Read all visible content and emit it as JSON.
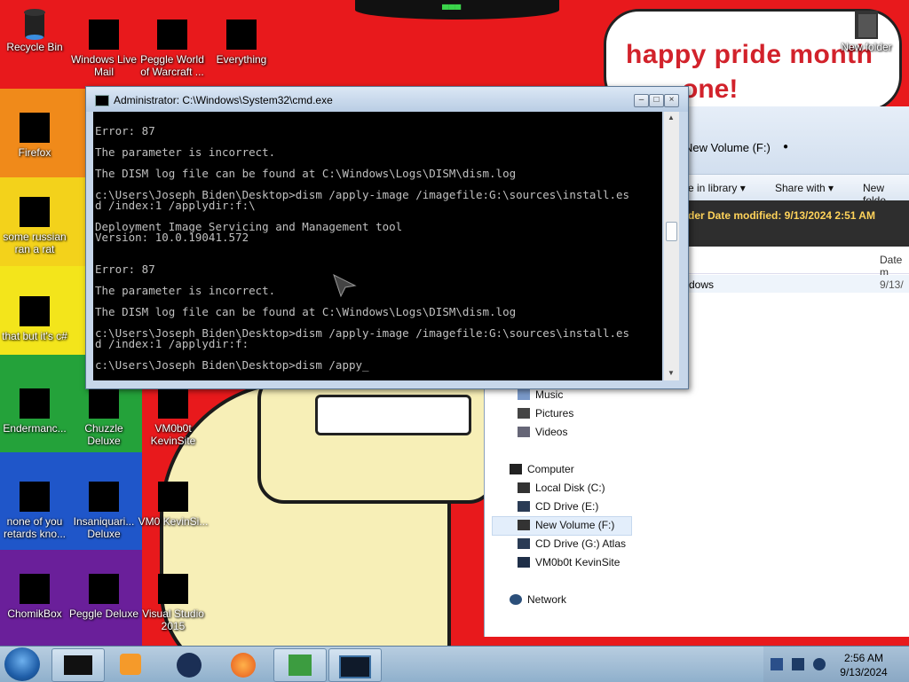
{
  "desktop": {
    "icons": [
      {
        "label": "Recycle Bin",
        "icon": "recycle-bin-icon"
      },
      {
        "label": "Windows Live Mail",
        "icon": "mail-icon"
      },
      {
        "label": "Peggle World of Warcraft ...",
        "icon": "peggle-icon"
      },
      {
        "label": "Everything",
        "icon": "search-icon"
      },
      {
        "label": "Firefox",
        "icon": "firefox-icon"
      },
      {
        "label": "some russian ran a rat",
        "icon": "file-icon"
      },
      {
        "label": "that but it's c#",
        "icon": "file-icon"
      },
      {
        "label": "Endermanc...",
        "icon": "app-icon"
      },
      {
        "label": "Chuzzle Deluxe",
        "icon": "game-icon"
      },
      {
        "label": "VM0b0t KevinSite",
        "icon": "app-icon"
      },
      {
        "label": "none of you retards kno...",
        "icon": "chrome-icon"
      },
      {
        "label": "Insaniquari... Deluxe",
        "icon": "game-icon"
      },
      {
        "label": "VM0 KevinSi...",
        "icon": "app-icon"
      },
      {
        "label": "ChomikBox",
        "icon": "chomikbox-icon"
      },
      {
        "label": "Peggle Deluxe",
        "icon": "peggle-icon"
      },
      {
        "label": "Visual Studio 2015",
        "icon": "visual-studio-icon"
      },
      {
        "label": "New folder",
        "icon": "folder-icon"
      }
    ],
    "wallpaper_text": "happy pride month",
    "wallpaper_text2": "one!"
  },
  "cmd": {
    "title": "Administrator: C:\\Windows\\System32\\cmd.exe",
    "lines": [
      "",
      "Error: 87",
      "",
      "The parameter is incorrect.",
      "",
      "The DISM log file can be found at C:\\Windows\\Logs\\DISM\\dism.log",
      "",
      "c:\\Users\\Joseph Biden\\Desktop>dism /apply-image /imagefile:G:\\sources\\install.es",
      "d /index:1 /applydir:f:\\",
      "",
      "Deployment Image Servicing and Management tool",
      "Version: 10.0.19041.572",
      "",
      "",
      "Error: 87",
      "",
      "The parameter is incorrect.",
      "",
      "The DISM log file can be found at C:\\Windows\\Logs\\DISM\\dism.log",
      "",
      "c:\\Users\\Joseph Biden\\Desktop>dism /apply-image /imagefile:G:\\sources\\install.es",
      "d /index:1 /applydir:f:",
      "",
      "c:\\Users\\Joseph Biden\\Desktop>dism /appy_"
    ]
  },
  "explorer": {
    "address": "New Volume (F:)",
    "commands": [
      "e in library ▾",
      "Share with ▾",
      "New folde"
    ],
    "details": "der  Date modified: 9/13/2024 2:51 AM",
    "column_date": "Date m",
    "row_name": "dows",
    "row_date": "9/13/",
    "nav": {
      "music": "Music",
      "pictures": "Pictures",
      "videos": "Videos",
      "computer": "Computer",
      "local_disk": "Local Disk (C:)",
      "cd_drive_e": "CD Drive (E:)",
      "new_volume": "New Volume (F:)",
      "cd_drive_g": "CD Drive (G:) Atlas",
      "vm": "VM0b0t KevinSite",
      "network": "Network"
    }
  },
  "taskbar": {
    "time": "2:56 AM",
    "date": "9/13/2024"
  }
}
